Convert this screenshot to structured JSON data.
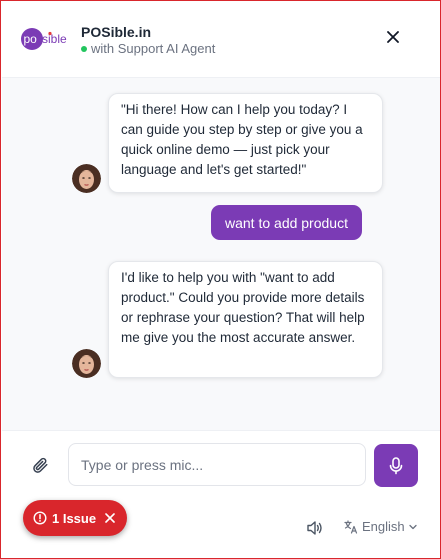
{
  "header": {
    "logo_text": "posible",
    "title": "POSible.in",
    "subtitle": "with Support AI Agent"
  },
  "chat": {
    "messages": [
      {
        "role": "agent",
        "text": "\"Hi there! How can I help you today? I can guide you step by step or give you a quick online demo — just pick your language and let's get started!\""
      },
      {
        "role": "user",
        "text": "want to add product"
      },
      {
        "role": "agent",
        "text": "I'd like to help you with \"want to add product.\" Could you provide more details or rephrase your question? That will help me give you the most accurate answer."
      }
    ]
  },
  "composer": {
    "placeholder": "Type or press mic..."
  },
  "footer": {
    "issue_label": "1 Issue",
    "language": "English"
  },
  "colors": {
    "brand": "#7b3bb5",
    "status_online": "#22c55e",
    "issue": "#d9262c"
  },
  "icons": [
    "close-icon",
    "paperclip-icon",
    "mic-icon",
    "alert-circle-icon",
    "speaker-icon",
    "translate-icon",
    "chevron-down-icon"
  ]
}
